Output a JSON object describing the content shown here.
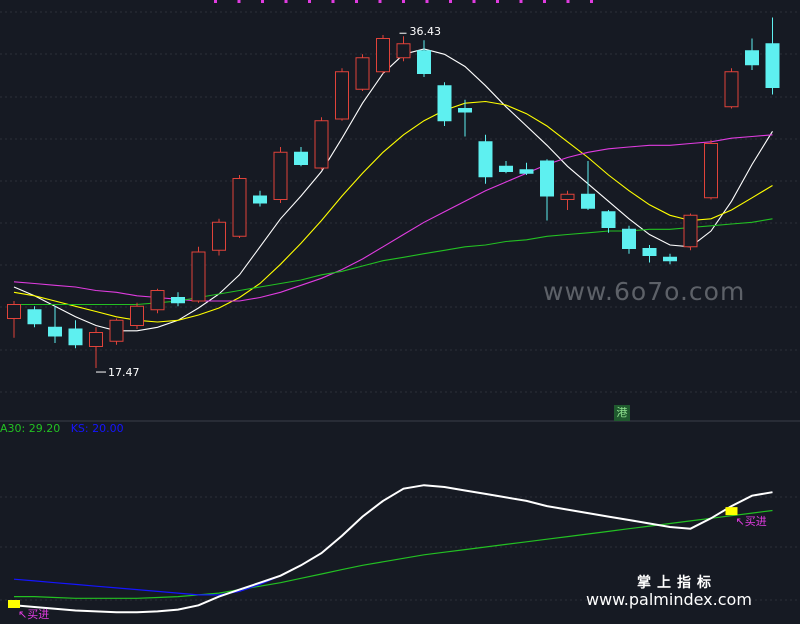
{
  "chart_data": [
    {
      "type": "candlestick",
      "panel": "main",
      "ylim": [
        14.5,
        38.5
      ],
      "candles": [
        {
          "o": 20.3,
          "h": 21.3,
          "l": 19.2,
          "c": 21.1
        },
        {
          "o": 20.8,
          "h": 21.0,
          "l": 19.8,
          "c": 20.0
        },
        {
          "o": 19.8,
          "h": 21.0,
          "l": 18.9,
          "c": 19.3
        },
        {
          "o": 19.7,
          "h": 20.2,
          "l": 18.6,
          "c": 18.8
        },
        {
          "o": 18.7,
          "h": 19.8,
          "l": 17.47,
          "c": 19.5
        },
        {
          "o": 19.0,
          "h": 20.3,
          "l": 18.8,
          "c": 20.2
        },
        {
          "o": 19.9,
          "h": 21.2,
          "l": 19.7,
          "c": 21.0
        },
        {
          "o": 20.8,
          "h": 22.0,
          "l": 20.6,
          "c": 21.9
        },
        {
          "o": 21.5,
          "h": 21.8,
          "l": 21.0,
          "c": 21.2
        },
        {
          "o": 21.3,
          "h": 24.4,
          "l": 21.2,
          "c": 24.1
        },
        {
          "o": 24.2,
          "h": 26.0,
          "l": 23.9,
          "c": 25.8
        },
        {
          "o": 25.0,
          "h": 28.5,
          "l": 24.9,
          "c": 28.3
        },
        {
          "o": 27.3,
          "h": 27.6,
          "l": 26.7,
          "c": 26.9
        },
        {
          "o": 27.1,
          "h": 30.1,
          "l": 26.9,
          "c": 29.8
        },
        {
          "o": 29.8,
          "h": 30.1,
          "l": 29.0,
          "c": 29.1
        },
        {
          "o": 28.9,
          "h": 31.8,
          "l": 28.8,
          "c": 31.6
        },
        {
          "o": 31.7,
          "h": 34.6,
          "l": 31.6,
          "c": 34.4
        },
        {
          "o": 33.4,
          "h": 35.4,
          "l": 33.3,
          "c": 35.2
        },
        {
          "o": 34.4,
          "h": 36.5,
          "l": 34.3,
          "c": 36.3
        },
        {
          "o": 35.2,
          "h": 36.43,
          "l": 35.0,
          "c": 36.0
        },
        {
          "o": 35.6,
          "h": 36.2,
          "l": 34.1,
          "c": 34.3
        },
        {
          "o": 33.6,
          "h": 33.8,
          "l": 31.3,
          "c": 31.6
        },
        {
          "o": 32.3,
          "h": 32.8,
          "l": 30.7,
          "c": 32.1
        },
        {
          "o": 30.4,
          "h": 30.8,
          "l": 28.0,
          "c": 28.4
        },
        {
          "o": 29.0,
          "h": 29.3,
          "l": 28.6,
          "c": 28.7
        },
        {
          "o": 28.8,
          "h": 29.2,
          "l": 28.5,
          "c": 28.6
        },
        {
          "o": 29.3,
          "h": 29.4,
          "l": 25.9,
          "c": 27.3
        },
        {
          "o": 27.1,
          "h": 27.6,
          "l": 26.5,
          "c": 27.4
        },
        {
          "o": 27.4,
          "h": 29.3,
          "l": 26.5,
          "c": 26.6
        },
        {
          "o": 26.4,
          "h": 26.5,
          "l": 25.2,
          "c": 25.5
        },
        {
          "o": 25.4,
          "h": 25.6,
          "l": 24.0,
          "c": 24.3
        },
        {
          "o": 24.3,
          "h": 24.5,
          "l": 23.5,
          "c": 23.9
        },
        {
          "o": 23.8,
          "h": 24.0,
          "l": 23.4,
          "c": 23.6
        },
        {
          "o": 24.4,
          "h": 26.3,
          "l": 24.2,
          "c": 26.2
        },
        {
          "o": 27.2,
          "h": 30.5,
          "l": 27.1,
          "c": 30.3
        },
        {
          "o": 32.4,
          "h": 34.6,
          "l": 32.3,
          "c": 34.4
        },
        {
          "o": 35.6,
          "h": 36.3,
          "l": 34.5,
          "c": 34.8
        },
        {
          "o": 36.0,
          "h": 37.5,
          "l": 33.1,
          "c": 33.5
        }
      ],
      "series": [
        {
          "color": "#ffffff",
          "values": [
            22.1,
            21.6,
            21.0,
            20.4,
            19.9,
            19.6,
            19.6,
            19.8,
            20.2,
            20.9,
            21.7,
            22.8,
            24.4,
            26.0,
            27.3,
            28.7,
            30.6,
            32.6,
            34.3,
            35.4,
            35.7,
            35.4,
            34.7,
            33.6,
            32.4,
            31.3,
            30.2,
            29.0,
            28.0,
            27.0,
            26.0,
            25.1,
            24.5,
            24.4,
            25.3,
            27.0,
            29.1,
            31.0
          ]
        },
        {
          "color": "#ffff00",
          "values": [
            21.8,
            21.6,
            21.3,
            21.0,
            20.7,
            20.4,
            20.2,
            20.1,
            20.2,
            20.5,
            20.9,
            21.5,
            22.3,
            23.4,
            24.6,
            25.9,
            27.3,
            28.6,
            29.8,
            30.8,
            31.6,
            32.2,
            32.6,
            32.7,
            32.5,
            32.0,
            31.3,
            30.4,
            29.5,
            28.5,
            27.6,
            26.8,
            26.2,
            25.9,
            26.0,
            26.5,
            27.2,
            27.9
          ]
        },
        {
          "color": "#e03ce0",
          "values": [
            22.4,
            22.3,
            22.2,
            22.1,
            21.9,
            21.8,
            21.6,
            21.5,
            21.4,
            21.3,
            21.3,
            21.3,
            21.5,
            21.8,
            22.2,
            22.6,
            23.1,
            23.7,
            24.4,
            25.1,
            25.8,
            26.4,
            27.0,
            27.6,
            28.1,
            28.6,
            29.1,
            29.5,
            29.8,
            30.0,
            30.1,
            30.2,
            30.2,
            30.3,
            30.4,
            30.6,
            30.7,
            30.8
          ]
        },
        {
          "color": "#23c023",
          "values": [
            21.1,
            21.1,
            21.1,
            21.1,
            21.1,
            21.1,
            21.1,
            21.2,
            21.3,
            21.5,
            21.7,
            21.9,
            22.1,
            22.3,
            22.5,
            22.8,
            23.0,
            23.3,
            23.6,
            23.8,
            24.0,
            24.2,
            24.4,
            24.5,
            24.7,
            24.8,
            25.0,
            25.1,
            25.2,
            25.3,
            25.3,
            25.4,
            25.4,
            25.5,
            25.6,
            25.7,
            25.8,
            26.0
          ]
        }
      ],
      "annotations": [
        {
          "text": "36.43",
          "type": "high",
          "index": 19,
          "value": 36.43
        },
        {
          "text": "17.47",
          "type": "low",
          "index": 4,
          "value": 17.47
        }
      ]
    },
    {
      "type": "line",
      "panel": "indicator",
      "ylim": [
        0,
        100
      ],
      "series": [
        {
          "color": "#23c023",
          "values": [
            10,
            10,
            9.5,
            9,
            9,
            9,
            9,
            9.5,
            10,
            11,
            12,
            14,
            16,
            18,
            20.5,
            23,
            25.5,
            28,
            30,
            32,
            34,
            35.5,
            37,
            38.5,
            40,
            41.5,
            43,
            44.5,
            46,
            47.5,
            49,
            50.5,
            52,
            53.5,
            55,
            56.5,
            58,
            59.5
          ]
        },
        {
          "color": "#1515ff",
          "values": [
            20,
            19,
            18,
            17,
            16,
            15,
            14,
            13,
            12,
            11,
            11,
            13,
            17,
            22,
            28,
            35,
            45,
            56,
            65,
            72,
            74,
            73,
            71,
            69,
            67,
            65,
            62,
            60,
            58,
            56,
            54,
            52,
            50,
            49,
            55,
            62,
            68,
            70
          ]
        },
        {
          "color": "#ffffff",
          "values": [
            5,
            4,
            3,
            2,
            1.5,
            1,
            1,
            1.5,
            2.5,
            5,
            10,
            14,
            18,
            22,
            28,
            35,
            45,
            56,
            65,
            72,
            74,
            73,
            71,
            69,
            67,
            65,
            62,
            60,
            58,
            56,
            54,
            52,
            50,
            49,
            55,
            62,
            68,
            70
          ]
        }
      ],
      "signals": [
        {
          "text": "买进",
          "index": 0
        },
        {
          "text": "买进",
          "index": 35
        }
      ]
    }
  ],
  "legend": {
    "ma30_label": "A30: 29.20",
    "ma30_color": "#23c023",
    "kl_label": "KS: 20.00",
    "kl_color": "#1515ff"
  },
  "watermarks": {
    "cn": "掌上指标",
    "url": "www.palmindex.com",
    "mark6070": "www.6o7o.com"
  },
  "badge": {
    "text": "港"
  }
}
